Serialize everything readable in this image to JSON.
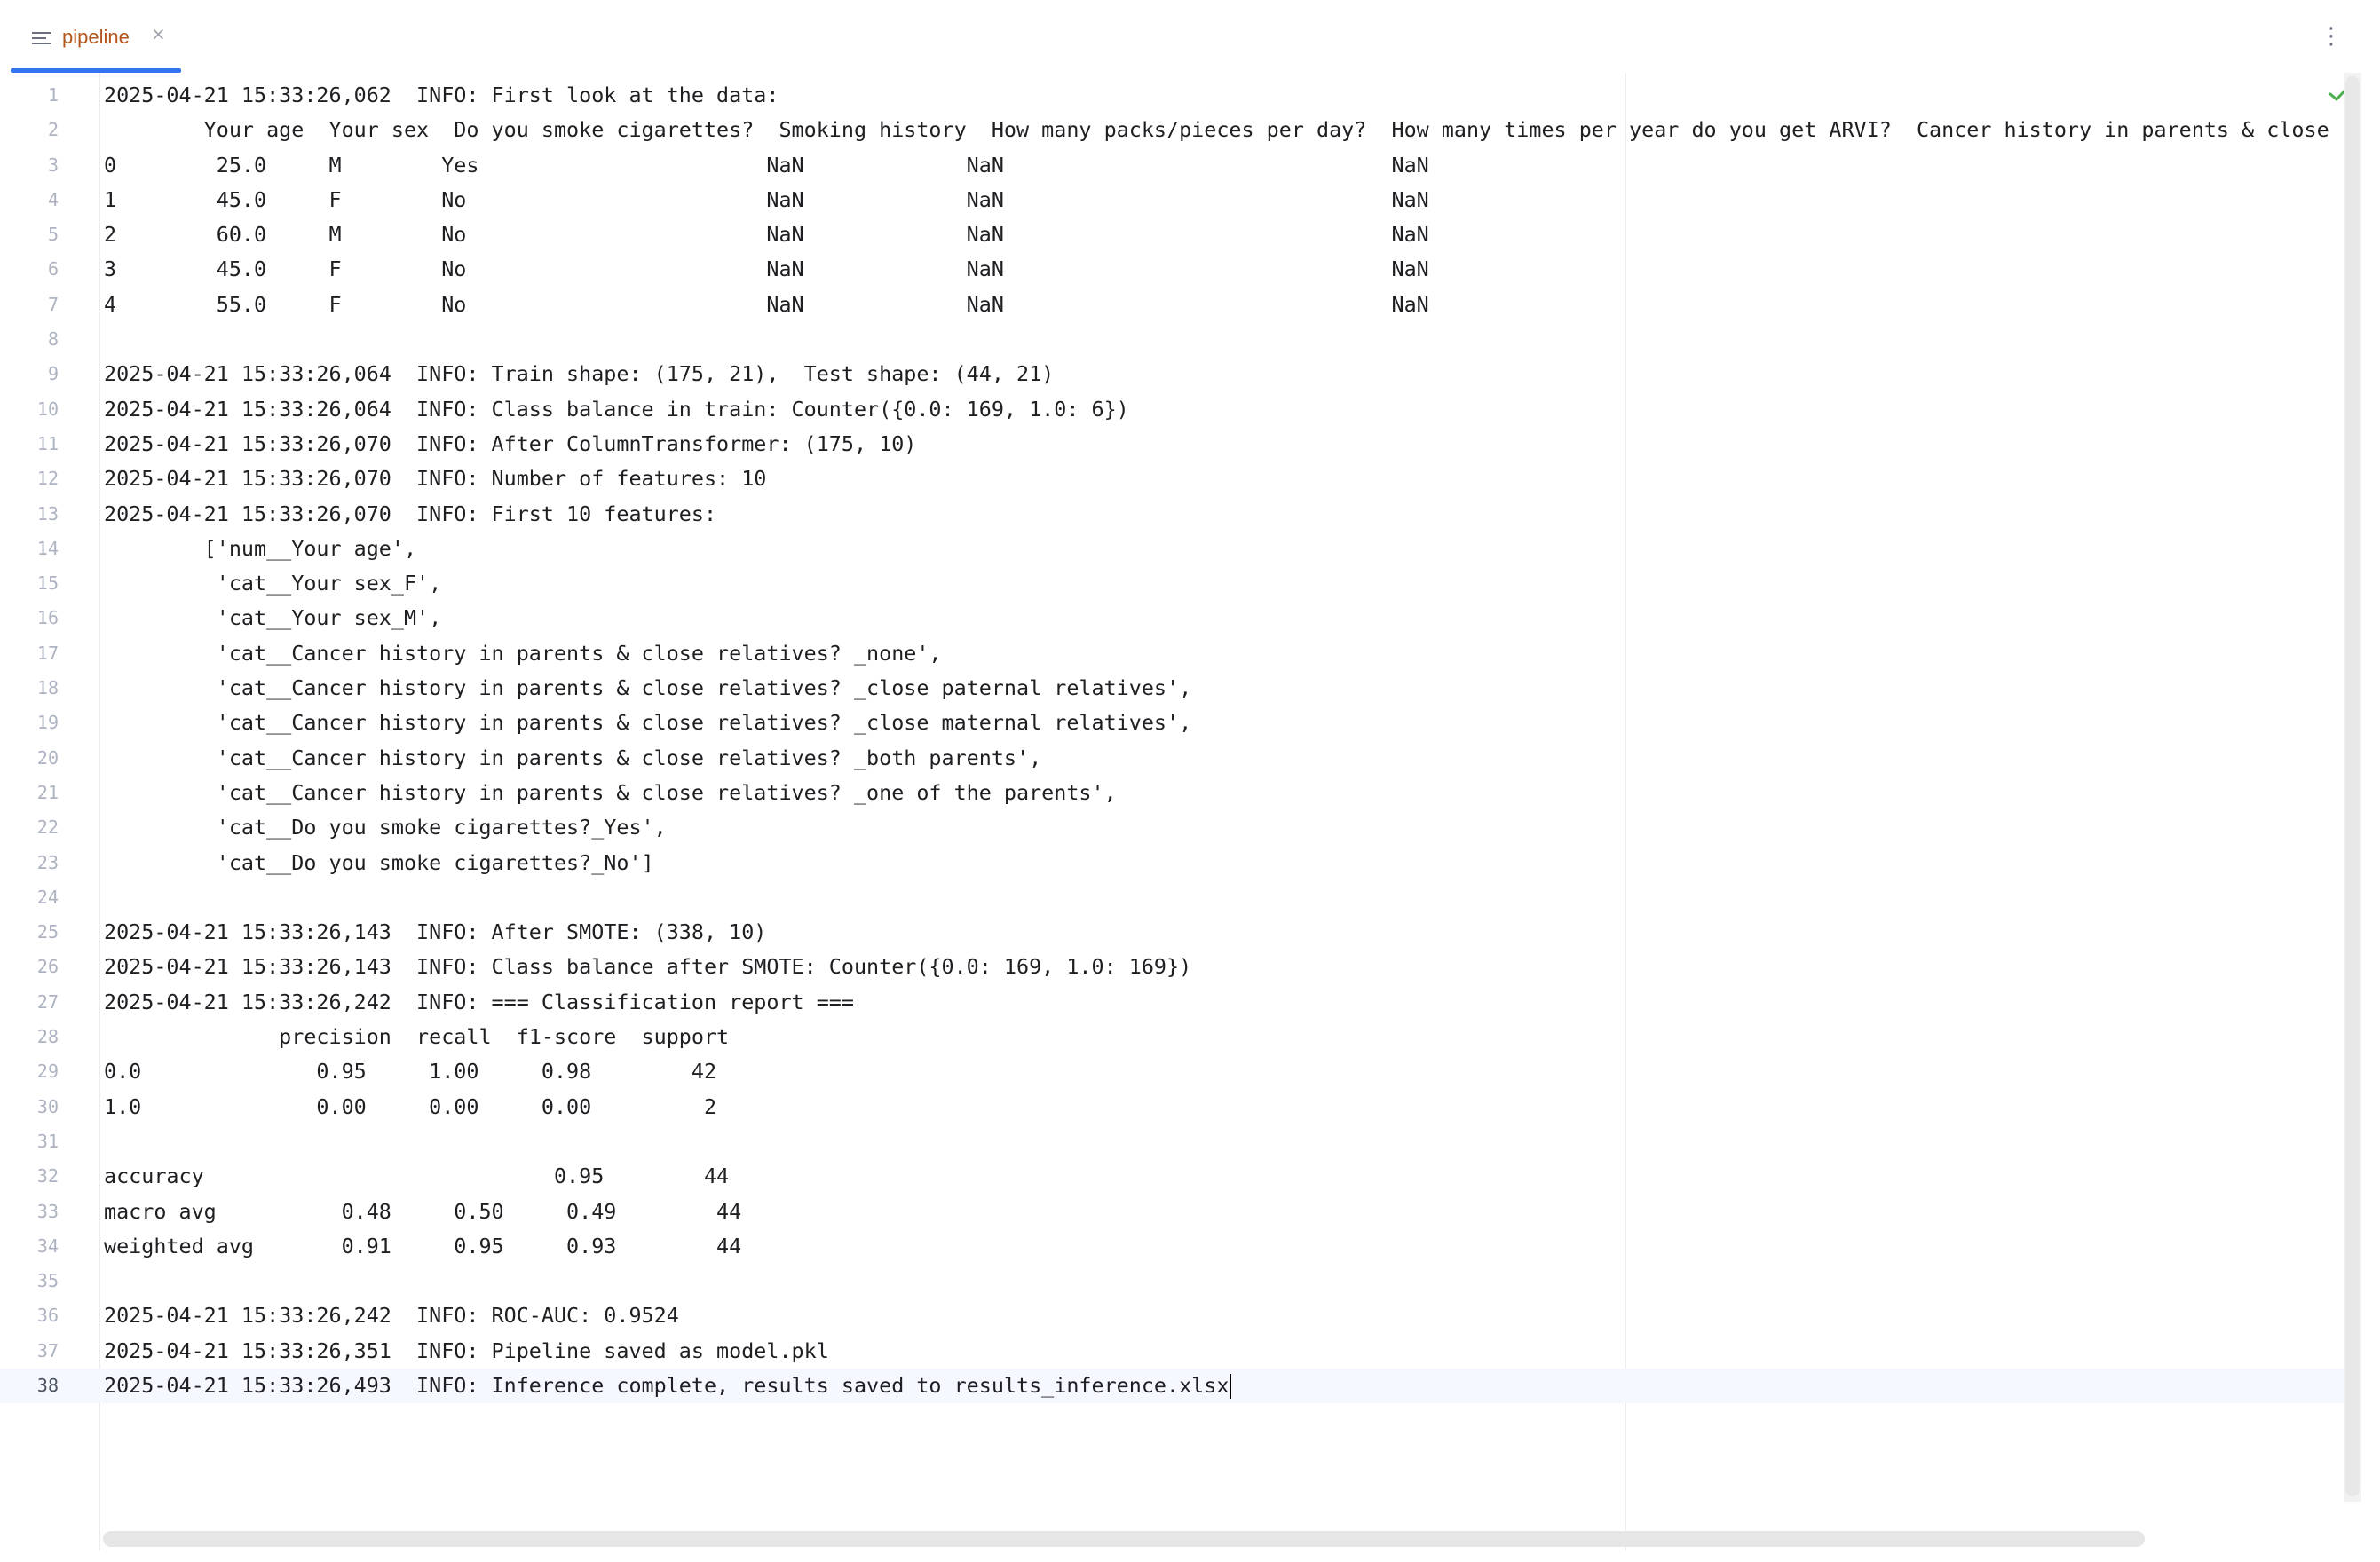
{
  "tab": {
    "label": "pipeline",
    "close": "×"
  },
  "toolbar": {
    "more": "⋮"
  },
  "editor": {
    "status_icon": "check-icon",
    "status_color": "#4caf50",
    "current_line": 38,
    "lines": [
      {
        "n": "1",
        "t": "2025-04-21 15:33:26,062  INFO: First look at the data:"
      },
      {
        "n": "2",
        "t": "        Your age  Your sex  Do you smoke cigarettes?  Smoking history  How many packs/pieces per day?  How many times per year do you get ARVI?  Cancer history in parents & close"
      },
      {
        "n": "3",
        "t": "0        25.0     M        Yes                       NaN             NaN                               NaN"
      },
      {
        "n": "4",
        "t": "1        45.0     F        No                        NaN             NaN                               NaN"
      },
      {
        "n": "5",
        "t": "2        60.0     M        No                        NaN             NaN                               NaN"
      },
      {
        "n": "6",
        "t": "3        45.0     F        No                        NaN             NaN                               NaN"
      },
      {
        "n": "7",
        "t": "4        55.0     F        No                        NaN             NaN                               NaN"
      },
      {
        "n": "8",
        "t": ""
      },
      {
        "n": "9",
        "t": "2025-04-21 15:33:26,064  INFO: Train shape: (175, 21),  Test shape: (44, 21)"
      },
      {
        "n": "10",
        "t": "2025-04-21 15:33:26,064  INFO: Class balance in train: Counter({0.0: 169, 1.0: 6})"
      },
      {
        "n": "11",
        "t": "2025-04-21 15:33:26,070  INFO: After ColumnTransformer: (175, 10)"
      },
      {
        "n": "12",
        "t": "2025-04-21 15:33:26,070  INFO: Number of features: 10"
      },
      {
        "n": "13",
        "t": "2025-04-21 15:33:26,070  INFO: First 10 features:"
      },
      {
        "n": "14",
        "t": "        ['num__Your age',"
      },
      {
        "n": "15",
        "t": "         'cat__Your sex_F',"
      },
      {
        "n": "16",
        "t": "         'cat__Your sex_M',"
      },
      {
        "n": "17",
        "t": "         'cat__Cancer history in parents & close relatives? _none',"
      },
      {
        "n": "18",
        "t": "         'cat__Cancer history in parents & close relatives? _close paternal relatives',"
      },
      {
        "n": "19",
        "t": "         'cat__Cancer history in parents & close relatives? _close maternal relatives',"
      },
      {
        "n": "20",
        "t": "         'cat__Cancer history in parents & close relatives? _both parents',"
      },
      {
        "n": "21",
        "t": "         'cat__Cancer history in parents & close relatives? _one of the parents',"
      },
      {
        "n": "22",
        "t": "         'cat__Do you smoke cigarettes?_Yes',"
      },
      {
        "n": "23",
        "t": "         'cat__Do you smoke cigarettes?_No']"
      },
      {
        "n": "24",
        "t": ""
      },
      {
        "n": "25",
        "t": "2025-04-21 15:33:26,143  INFO: After SMOTE: (338, 10)"
      },
      {
        "n": "26",
        "t": "2025-04-21 15:33:26,143  INFO: Class balance after SMOTE: Counter({0.0: 169, 1.0: 169})"
      },
      {
        "n": "27",
        "t": "2025-04-21 15:33:26,242  INFO: === Classification report ==="
      },
      {
        "n": "28",
        "t": "              precision  recall  f1-score  support"
      },
      {
        "n": "29",
        "t": "0.0              0.95     1.00     0.98        42"
      },
      {
        "n": "30",
        "t": "1.0              0.00     0.00     0.00         2"
      },
      {
        "n": "31",
        "t": ""
      },
      {
        "n": "32",
        "t": "accuracy                            0.95        44"
      },
      {
        "n": "33",
        "t": "macro avg          0.48     0.50     0.49        44"
      },
      {
        "n": "34",
        "t": "weighted avg       0.91     0.95     0.93        44"
      },
      {
        "n": "35",
        "t": ""
      },
      {
        "n": "36",
        "t": "2025-04-21 15:33:26,242  INFO: ROC-AUC: 0.9524"
      },
      {
        "n": "37",
        "t": "2025-04-21 15:33:26,351  INFO: Pipeline saved as model.pkl"
      },
      {
        "n": "38",
        "t": "2025-04-21 15:33:26,493  INFO: Inference complete, results saved to results_inference.xlsx"
      }
    ]
  }
}
